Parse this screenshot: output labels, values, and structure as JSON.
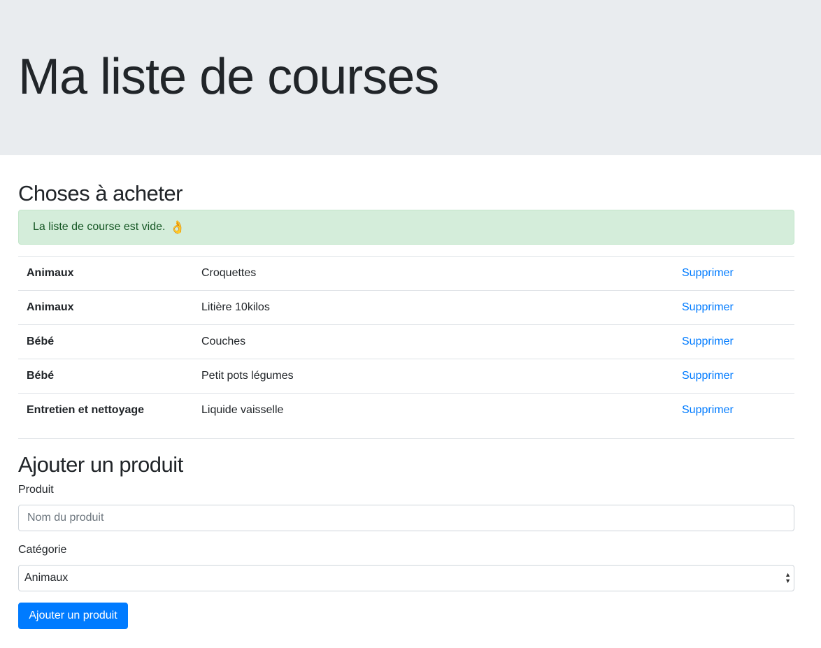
{
  "header": {
    "title": "Ma liste de courses"
  },
  "shopping": {
    "title": "Choses à acheter",
    "alert": {
      "text": "La liste de course est vide.",
      "emoji": "👌",
      "color": "#d4edda"
    },
    "items": [
      {
        "category": "Animaux",
        "product": "Croquettes",
        "action": "Supprimer"
      },
      {
        "category": "Animaux",
        "product": "Litière 10kilos",
        "action": "Supprimer"
      },
      {
        "category": "Bébé",
        "product": "Couches",
        "action": "Supprimer"
      },
      {
        "category": "Bébé",
        "product": "Petit pots légumes",
        "action": "Supprimer"
      },
      {
        "category": "Entretien et nettoyage",
        "product": "Liquide vaisselle",
        "action": "Supprimer"
      }
    ]
  },
  "form": {
    "title": "Ajouter un produit",
    "product_label": "Produit",
    "product_placeholder": "Nom du produit",
    "product_value": "",
    "category_label": "Catégorie",
    "category_selected": "Animaux",
    "submit_label": "Ajouter un produit",
    "accent_color": "#007bff"
  }
}
